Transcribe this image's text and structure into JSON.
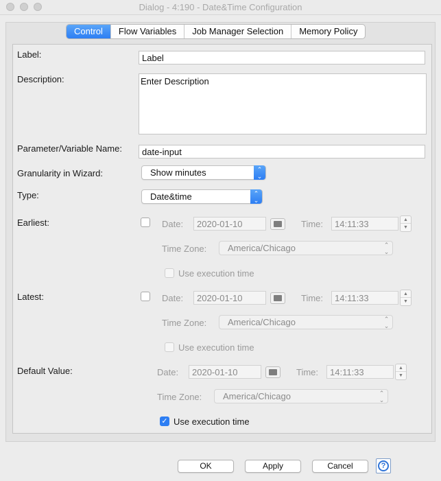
{
  "window": {
    "title": "Dialog - 4:190 - Date&Time Configuration"
  },
  "tabs": [
    {
      "label": "Control",
      "active": true
    },
    {
      "label": "Flow Variables",
      "active": false
    },
    {
      "label": "Job Manager Selection",
      "active": false
    },
    {
      "label": "Memory Policy",
      "active": false
    }
  ],
  "form": {
    "label": {
      "label": "Label:",
      "value": "Label"
    },
    "description": {
      "label": "Description:",
      "value": "Enter Description"
    },
    "parameter": {
      "label": "Parameter/Variable Name:",
      "value": "date-input"
    },
    "granularity": {
      "label": "Granularity in Wizard:",
      "value": "Show minutes"
    },
    "type": {
      "label": "Type:",
      "value": "Date&time"
    },
    "earliest": {
      "label": "Earliest:",
      "enabled": false,
      "date_label": "Date:",
      "date": "2020-01-10",
      "time_label": "Time:",
      "time": "14:11:33",
      "tz_label": "Time Zone:",
      "tz": "America/Chicago",
      "exec_label": "Use execution time",
      "use_exec": false
    },
    "latest": {
      "label": "Latest:",
      "enabled": false,
      "date_label": "Date:",
      "date": "2020-01-10",
      "time_label": "Time:",
      "time": "14:11:33",
      "tz_label": "Time Zone:",
      "tz": "America/Chicago",
      "exec_label": "Use execution time",
      "use_exec": false
    },
    "default": {
      "label": "Default Value:",
      "date_label": "Date:",
      "date": "2020-01-10",
      "time_label": "Time:",
      "time": "14:11:33",
      "tz_label": "Time Zone:",
      "tz": "America/Chicago",
      "exec_label": "Use execution time",
      "use_exec": true
    }
  },
  "buttons": {
    "ok": "OK",
    "apply": "Apply",
    "cancel": "Cancel",
    "help": "?"
  },
  "icons": {
    "spinner_up": "▲",
    "spinner_down": "▼",
    "combo_arrows": "⌃⌄",
    "checkmark": "✓"
  },
  "colors": {
    "accent": "#2d7ef3"
  }
}
